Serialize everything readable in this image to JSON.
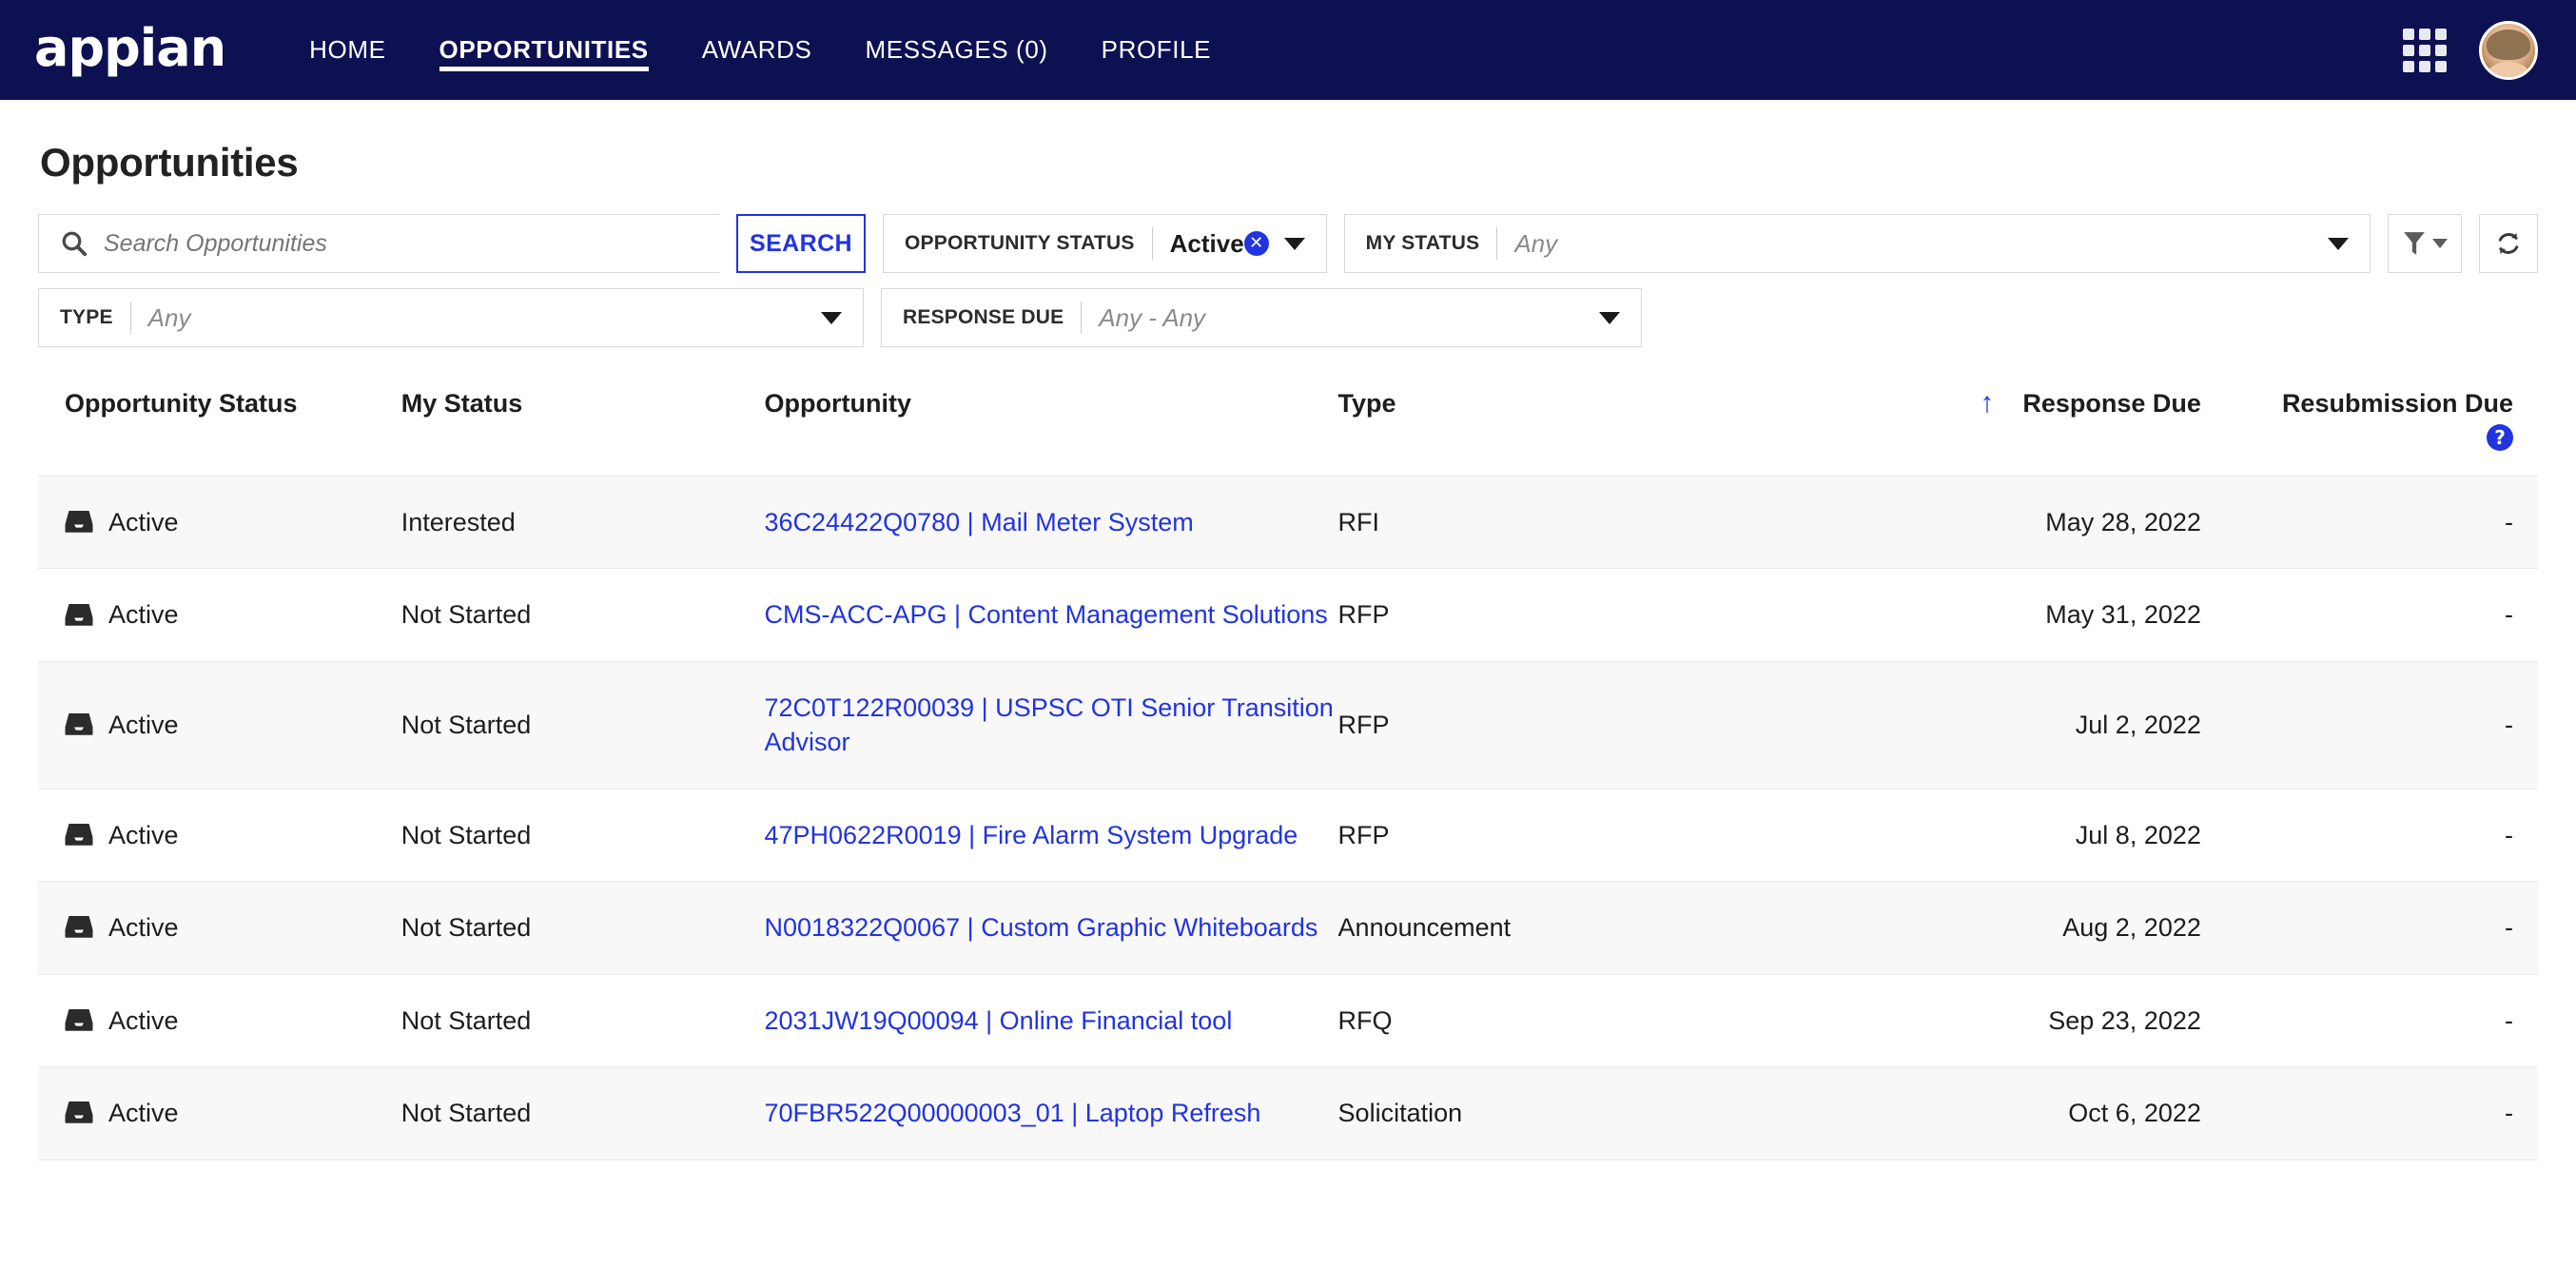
{
  "nav": {
    "brand": "appian",
    "links": [
      {
        "label": "HOME",
        "active": false
      },
      {
        "label": "OPPORTUNITIES",
        "active": true
      },
      {
        "label": "AWARDS",
        "active": false
      },
      {
        "label": "MESSAGES (0)",
        "active": false
      },
      {
        "label": "PROFILE",
        "active": false
      }
    ],
    "grid_icon": "apps-grid-icon",
    "avatar": "user-avatar"
  },
  "page": {
    "title": "Opportunities"
  },
  "search": {
    "placeholder": "Search Opportunities",
    "value": "",
    "button_label": "SEARCH",
    "icon": "search-icon"
  },
  "filters": {
    "opportunity_status": {
      "label": "OPPORTUNITY STATUS",
      "value": "Active",
      "is_placeholder": false,
      "clear_label": "✕"
    },
    "my_status": {
      "label": "MY STATUS",
      "value": "Any",
      "is_placeholder": true
    },
    "type": {
      "label": "TYPE",
      "value": "Any",
      "is_placeholder": true
    },
    "response_due": {
      "label": "RESPONSE DUE",
      "value": "Any - Any",
      "is_placeholder": true
    },
    "filter_button": "filter-funnel-icon",
    "refresh_button": "refresh-icon"
  },
  "table": {
    "columns": [
      "Opportunity Status",
      "My Status",
      "Opportunity",
      "Type",
      "Response Due",
      "Resubmission Due"
    ],
    "sort": {
      "column": "Response Due",
      "direction": "ascending",
      "glyph": "↑"
    },
    "help_glyph": "?",
    "rows": [
      {
        "opportunity_status": "Active",
        "my_status": "Interested",
        "opportunity": "36C24422Q0780 | Mail Meter System",
        "type": "RFI",
        "response_due": "May 28, 2022",
        "resubmission_due": "-"
      },
      {
        "opportunity_status": "Active",
        "my_status": "Not Started",
        "opportunity": "CMS-ACC-APG | Content Management Solutions",
        "type": "RFP",
        "response_due": "May 31, 2022",
        "resubmission_due": "-"
      },
      {
        "opportunity_status": "Active",
        "my_status": "Not Started",
        "opportunity": "72C0T122R00039 | USPSC OTI Senior Transition Advisor",
        "type": "RFP",
        "response_due": "Jul 2, 2022",
        "resubmission_due": "-"
      },
      {
        "opportunity_status": "Active",
        "my_status": "Not Started",
        "opportunity": "47PH0622R0019 | Fire Alarm System Upgrade",
        "type": "RFP",
        "response_due": "Jul 8, 2022",
        "resubmission_due": "-"
      },
      {
        "opportunity_status": "Active",
        "my_status": "Not Started",
        "opportunity": "N0018322Q0067 | Custom Graphic Whiteboards",
        "type": "Announcement",
        "response_due": "Aug 2, 2022",
        "resubmission_due": "-"
      },
      {
        "opportunity_status": "Active",
        "my_status": "Not Started",
        "opportunity": "2031JW19Q00094 | Online Financial tool",
        "type": "RFQ",
        "response_due": "Sep 23, 2022",
        "resubmission_due": "-"
      },
      {
        "opportunity_status": "Active",
        "my_status": "Not Started",
        "opportunity": "70FBR522Q00000003_01 | Laptop Refresh",
        "type": "Solicitation",
        "response_due": "Oct 6, 2022",
        "resubmission_due": "-"
      }
    ]
  },
  "colors": {
    "nav_background": "#0d1051",
    "accent_blue": "#2233e0",
    "row_stripe": "#f8f8f9",
    "text": "#1d1d1d"
  }
}
